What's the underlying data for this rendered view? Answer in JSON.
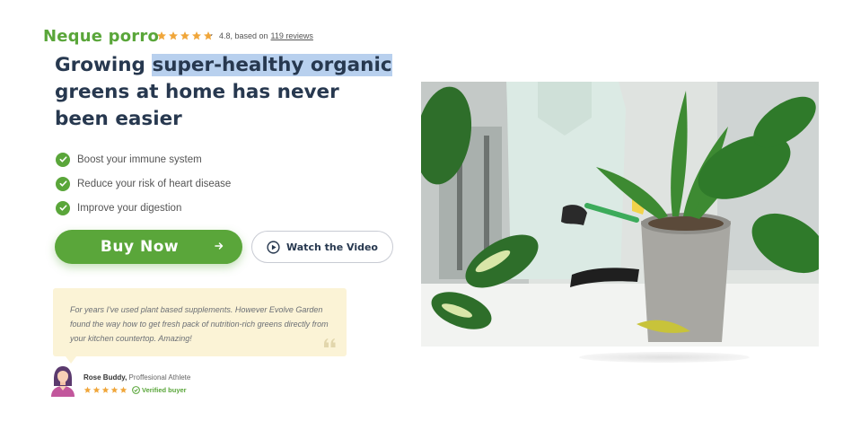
{
  "brand": "Neque porro",
  "rating": {
    "score": 4.8,
    "text": "4.8, based on",
    "reviews_link": "119 reviews"
  },
  "headline": {
    "part1": "Growing ",
    "highlighted": "super-healthy organic",
    "part2": " greens at home has never been easier"
  },
  "benefits": [
    "Boost your immune system",
    "Reduce your risk of heart disease",
    "Improve your digestion"
  ],
  "buttons": {
    "buy": "Buy Now",
    "watch": "Watch the Video"
  },
  "testimonial": {
    "quote": "For years I've used plant based supplements. However Evolve Garden found the way how to get fresh pack of nutrition-rich greens directly from your kitchen countertop. Amazing!",
    "author_name": "Rose Buddy,",
    "author_role": "Proffesional Athlete",
    "rating": 5,
    "verified": "Verified buyer"
  },
  "icons": {
    "rating": "star-icon",
    "benefit": "check-circle-icon",
    "buy_arrow": "arrow-right-icon",
    "watch": "play-circle-icon",
    "quote": "quote-icon",
    "verified": "check-circle-icon"
  },
  "colors": {
    "brand_green": "#5aa63a",
    "headline": "#27384f",
    "star": "#f0a63a",
    "highlight": "#b8d0ee",
    "testimonial_bg": "#fbf3d6"
  }
}
